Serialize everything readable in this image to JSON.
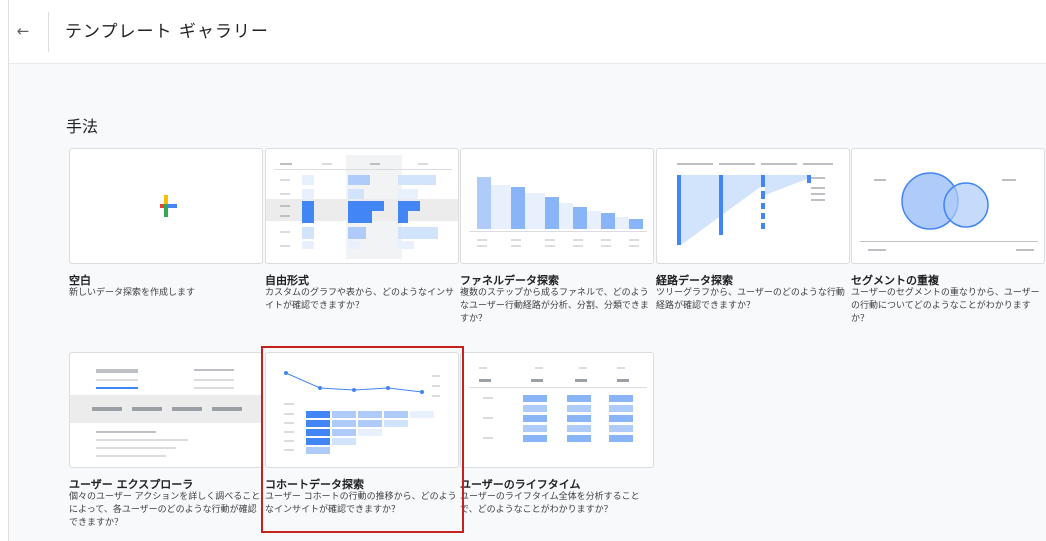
{
  "header": {
    "back_label": "←",
    "title": "テンプレート ギャラリー"
  },
  "section_title": "手法",
  "cards": [
    {
      "name": "空白",
      "desc": "新しいデータ探索を作成します",
      "icon": "plus-icon"
    },
    {
      "name": "自由形式",
      "desc": "カスタムのグラフや表から、どのようなインサイトが確認できますか？"
    },
    {
      "name": "ファネルデータ探索",
      "desc": "複数のステップから成るファネルで、どのようなユーザー行動経路が分析、分割、分類できますか？"
    },
    {
      "name": "経路データ探索",
      "desc": "ツリーグラフから、ユーザーのどのような行動経路が確認できますか？"
    },
    {
      "name": "セグメントの重複",
      "desc": "ユーザーのセグメントの重なりから、ユーザーの行動についてどのようなことがわかりますか？"
    },
    {
      "name": "ユーザー エクスプローラ",
      "desc": "個々のユーザー アクションを詳しく調べることによって、各ユーザーのどのような行動が確認できますか？"
    },
    {
      "name": "コホートデータ探索",
      "desc": "ユーザー コホートの行動の推移から、どのようなインサイトが確認できますか？"
    },
    {
      "name": "ユーザーのライフタイム",
      "desc": "ユーザーのライフタイム全体を分析することで、どのようなことがわかりますか？"
    }
  ],
  "colors": {
    "accent": "#4285f4",
    "highlight": "#c5221f"
  }
}
